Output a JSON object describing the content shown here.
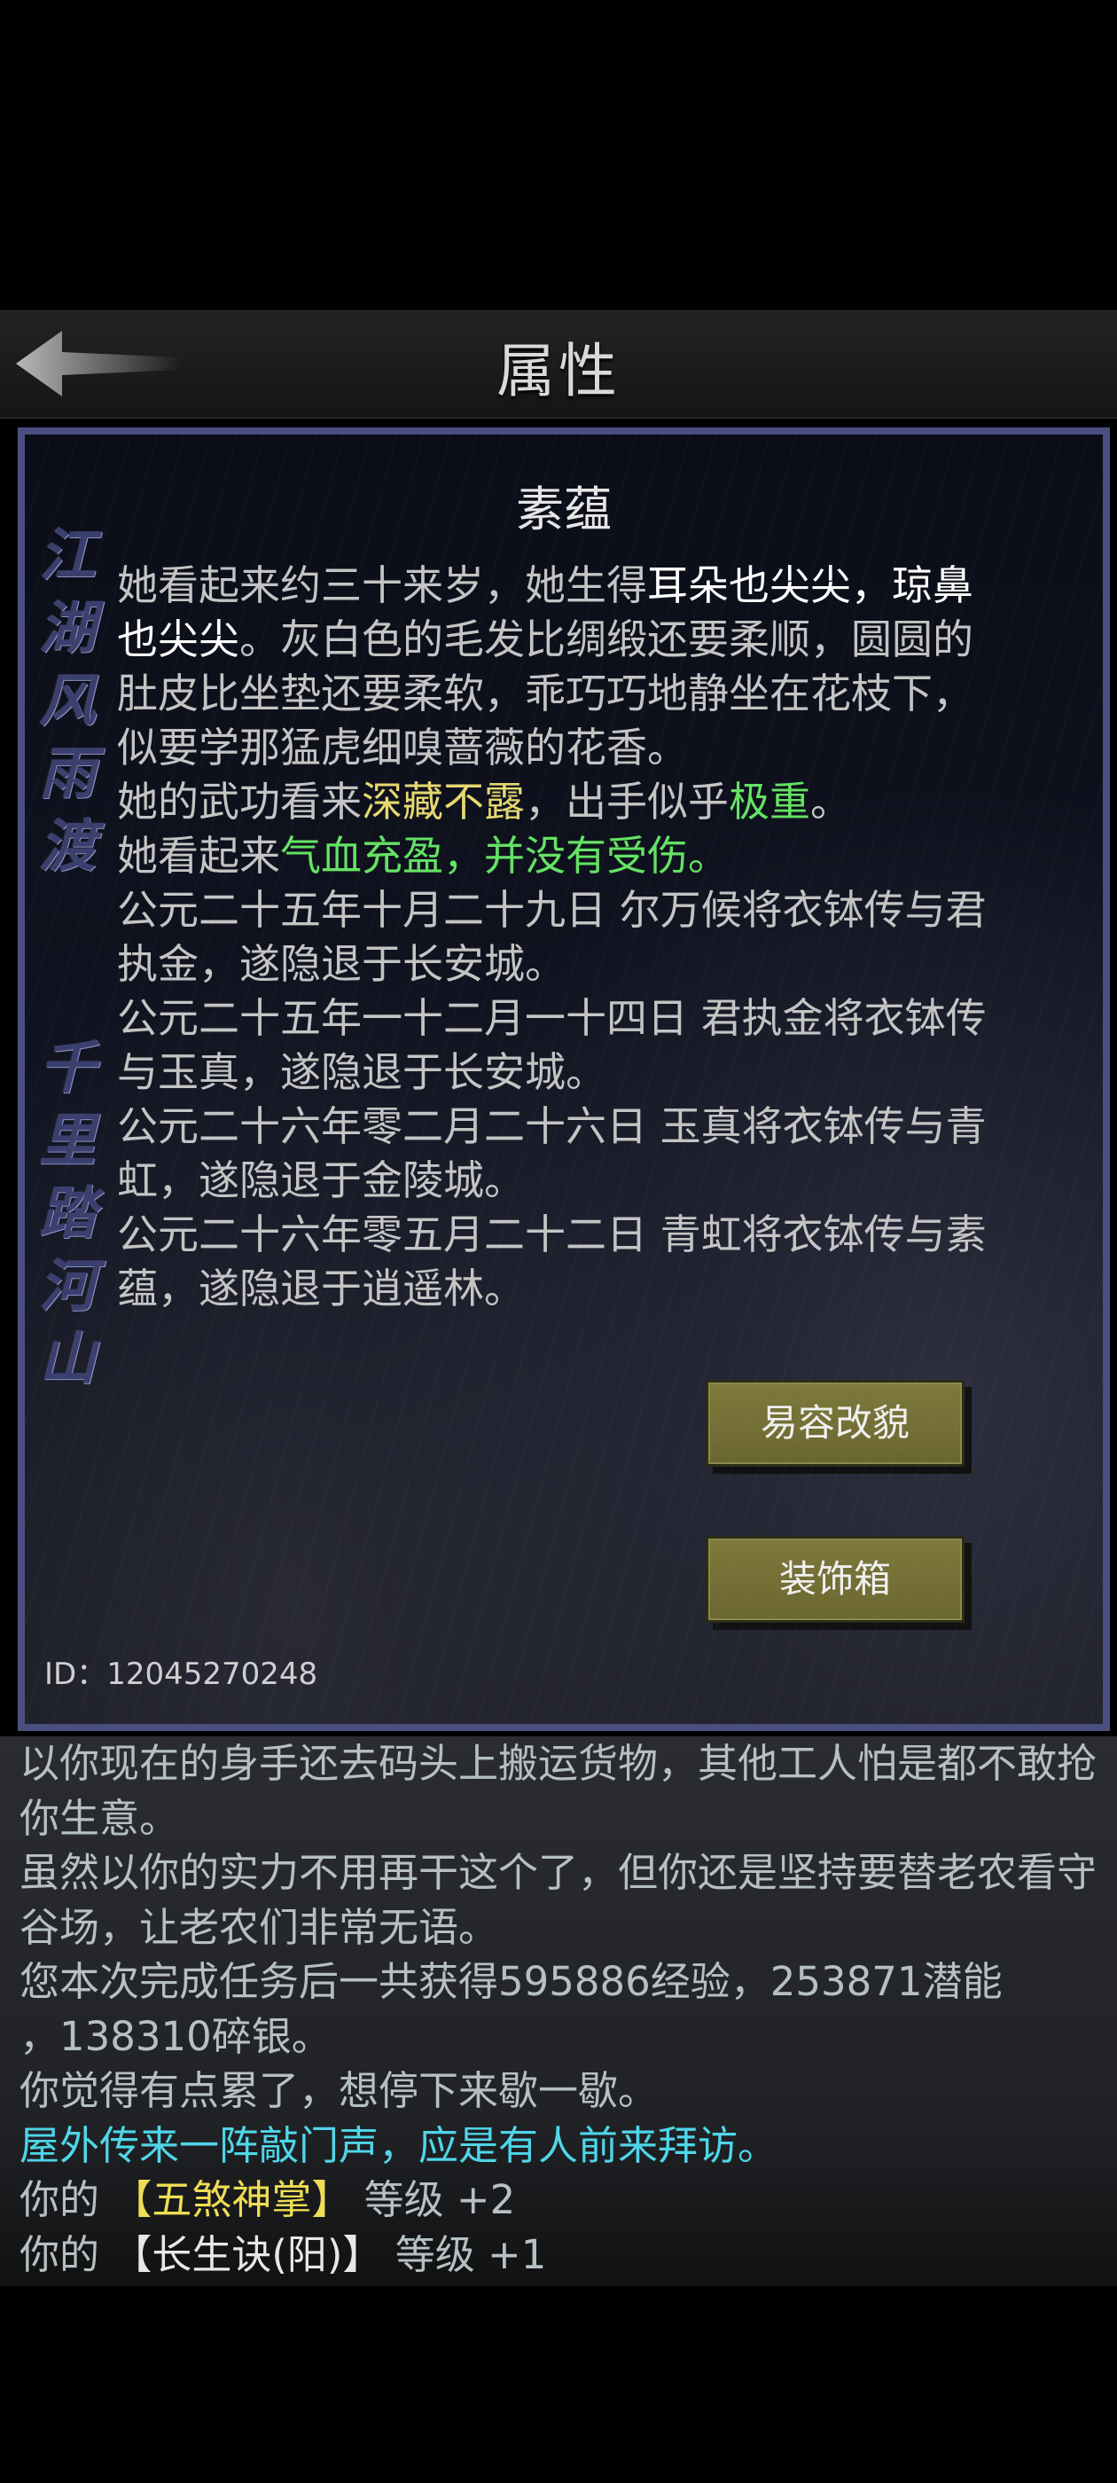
{
  "header": {
    "title": "属性"
  },
  "panel": {
    "calligraphy_top": [
      "江",
      "湖",
      "风",
      "雨",
      "渡"
    ],
    "calligraphy_bottom": [
      "千",
      "里",
      "踏",
      "河",
      "山"
    ],
    "character_name": "素蕴",
    "desc": {
      "a1": "她看起来约三十来岁，她生得",
      "a2": "耳朵也尖尖，琼鼻也尖尖",
      "a3": "。灰白色的毛发比绸缎还要柔顺，圆圆的肚皮比坐垫还要柔软，乖巧巧地静坐在花枝下，似要学那猛虎细嗅蔷薇的花香。",
      "b1": "她的武功看来",
      "b2": "深藏不露",
      "b3": "，出手似乎",
      "b4": "极重",
      "b5": "。",
      "c1": "她看起来",
      "c2": "气血充盈，并没有受伤。",
      "d": "公元二十五年十月二十九日 尔万候将衣钵传与君执金，遂隐退于长安城。",
      "e": "公元二十五年一十二月一十四日 君执金将衣钵传与玉真，遂隐退于长安城。",
      "f": "公元二十六年零二月二十六日 玉真将衣钵传与青虹，遂隐退于金陵城。",
      "g": "公元二十六年零五月二十二日 青虹将衣钵传与素蕴，遂隐退于逍遥林。"
    },
    "btn_disguise": "易容改貌",
    "btn_wardrobe": "装饰箱",
    "id_text": "ID：12045270248"
  },
  "log": {
    "l1": "以你现在的身手还去码头上搬运货物，其他工人怕是都不敢抢你生意。",
    "l2": "虽然以你的实力不用再干这个了，但你还是坚持要替老农看守谷场，让老农们非常无语。",
    "l3a": "您本次完成任务后一共获得595886经验，253871潜能",
    "l3b": "，138310碎银。",
    "l4": "你觉得有点累了，想停下来歇一歇。",
    "l5": "屋外传来一阵敲门声，应是有人前来拜访。",
    "l6a": "你的 ",
    "l6b": "【五煞神掌】",
    "l6c": " 等级 +2",
    "l7a": "你的 ",
    "l7b": "【长生诀(阳)】",
    "l7c": " 等级 +1"
  }
}
